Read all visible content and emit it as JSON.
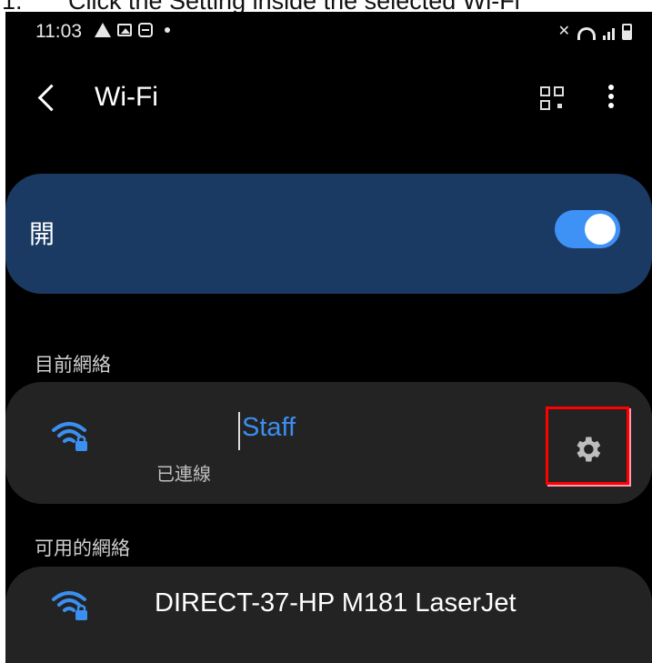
{
  "caption": {
    "number": "1.",
    "text": "Click the Setting inside the selected Wi-Fi"
  },
  "status_bar": {
    "time": "11:03",
    "icons": [
      "warning-icon",
      "image-icon",
      "message-icon",
      "dot-icon",
      "mute-icon",
      "wifi-icon",
      "signal-icon",
      "battery-icon"
    ]
  },
  "app_bar": {
    "title": "Wi-Fi",
    "icons": [
      "back-icon",
      "qr-code-icon",
      "more-icon"
    ]
  },
  "master_switch": {
    "label": "開",
    "state": "on"
  },
  "current_network": {
    "section_title": "目前網絡",
    "name": "Staff",
    "status": "已連線",
    "settings_icon": "gear-icon"
  },
  "available_networks": {
    "section_title": "可用的網絡",
    "items": [
      {
        "name": "DIRECT-37-HP M181 LaserJet"
      }
    ]
  },
  "colors": {
    "accent": "#3a8ff0",
    "switch_card": "#1b3a63",
    "highlight": "#ff0000"
  }
}
